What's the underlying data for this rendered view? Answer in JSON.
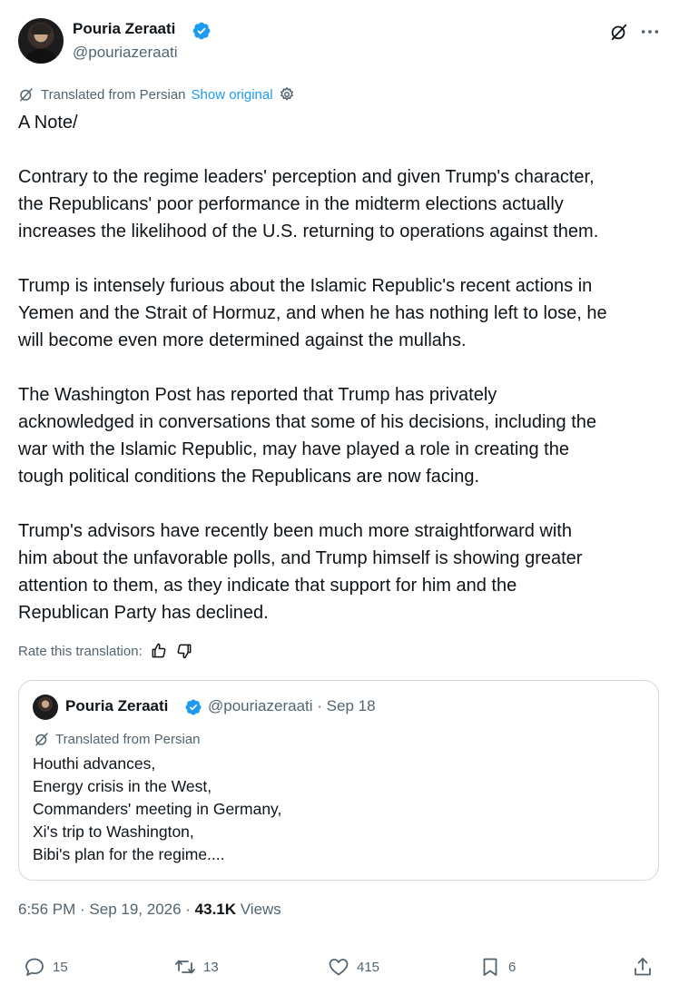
{
  "author": {
    "name": "Pouria Zeraati",
    "handle": "@pouriazeraati"
  },
  "translation": {
    "label": "Translated from Persian",
    "show_original": "Show original"
  },
  "post": {
    "paragraphs": [
      "A Note/",
      "Contrary to the regime leaders' perception and given Trump's character,\nthe Republicans' poor performance in the midterm elections actually\nincreases the likelihood of the U.S. returning to operations against them.",
      "Trump is intensely furious about the Islamic Republic's recent actions in\nYemen and the Strait of Hormuz, and when he has nothing left to lose, he\nwill become even more determined against the mullahs.",
      "The Washington Post has reported that Trump has privately\nacknowledged in conversations that some of his decisions, including the\nwar with the Islamic Republic, may have played a role in creating the\ntough political conditions the Republicans are now facing.",
      "Trump's advisors have recently been much more straightforward with\nhim about the unfavorable polls, and Trump himself is showing greater\nattention to them, as they indicate that support for him and the\nRepublican Party has declined."
    ]
  },
  "rate": {
    "label": "Rate this translation:"
  },
  "quote": {
    "name": "Pouria Zeraati",
    "handle_date": "@pouriazeraati · Sep 18",
    "translation_label": "Translated from Persian",
    "lines": [
      "Houthi advances,",
      "Energy crisis in the West,",
      "Commanders' meeting in Germany,",
      "Xi's trip to Washington,",
      "Bibi's plan for the regime...."
    ]
  },
  "meta": {
    "timestamp": "6:56 PM · Sep 19, 2026 · ",
    "views_count": "43.1K",
    "views_label": " Views"
  },
  "actions": {
    "replies": "15",
    "reposts": "13",
    "likes": "415",
    "bookmarks": "6"
  },
  "colors": {
    "accent": "#1d9bf0",
    "muted": "#536471",
    "text": "#0f1419",
    "border": "#cfd9de"
  }
}
